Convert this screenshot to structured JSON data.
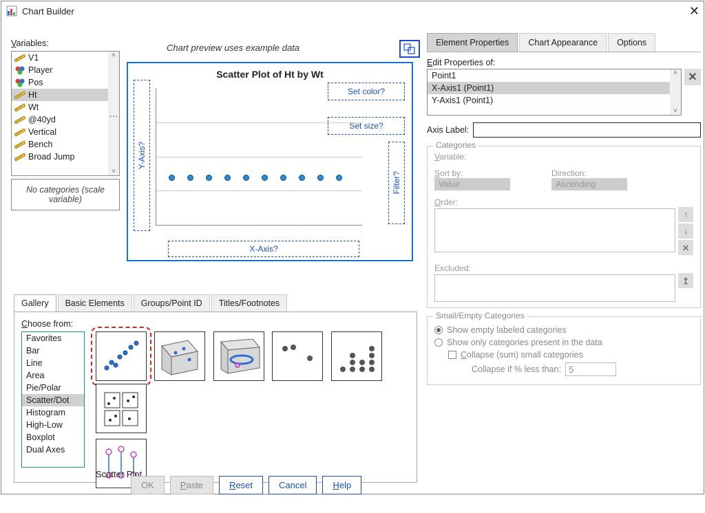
{
  "window": {
    "title": "Chart Builder"
  },
  "left": {
    "variables_label": "Variables:",
    "variables": [
      "V1",
      "Player",
      "Pos",
      "Ht",
      "Wt",
      "@40yd",
      "Vertical",
      "Bench",
      "Broad Jump"
    ],
    "selected_variable_index": 3,
    "no_categories": "No categories (scale variable)",
    "preview_hint": "Chart preview uses example data"
  },
  "chart_data": {
    "type": "scatter",
    "title": "Scatter Plot of Ht by Wt",
    "x": [
      1,
      2,
      3,
      4,
      5,
      6,
      7,
      8,
      9,
      10
    ],
    "y": [
      0,
      0,
      0,
      0,
      0,
      0,
      0,
      0,
      0,
      0
    ],
    "xlabel": "",
    "ylabel": "",
    "dropzones": {
      "color": "Set color?",
      "size": "Set size?",
      "filter": "Filter?",
      "x": "X-Axis?",
      "y": "Y-Axis?"
    }
  },
  "gallery": {
    "tabs": [
      "Gallery",
      "Basic Elements",
      "Groups/Point ID",
      "Titles/Footnotes"
    ],
    "active_tab": 0,
    "choose_from_label": "Choose from:",
    "types": [
      "Favorites",
      "Bar",
      "Line",
      "Area",
      "Pie/Polar",
      "Scatter/Dot",
      "Histogram",
      "High-Low",
      "Boxplot",
      "Dual Axes"
    ],
    "selected_type_index": 5,
    "selected_thumb_label": "Scatter Plot"
  },
  "buttons": {
    "ok": "OK",
    "paste": "Paste",
    "reset": "Reset",
    "cancel": "Cancel",
    "help": "Help"
  },
  "right": {
    "tabs": [
      "Element Properties",
      "Chart Appearance",
      "Options"
    ],
    "active_tab": 0,
    "edit_props_label": "Edit Properties of:",
    "props_list": [
      "Point1",
      "X-Axis1 (Point1)",
      "Y-Axis1 (Point1)"
    ],
    "selected_prop_index": 1,
    "axis_label_label": "Axis Label:",
    "axis_label_value": "",
    "categories": {
      "title": "Categories",
      "variable_label": "Variable:",
      "sort_by_label": "Sort by:",
      "sort_by_value": "Value",
      "direction_label": "Direction:",
      "direction_value": "Ascending",
      "order_label": "Order:",
      "excluded_label": "Excluded:"
    },
    "small_empty": {
      "title": "Small/Empty Categories",
      "opt1": "Show empty labeled categories",
      "opt2": "Show only categories present in the data",
      "collapse_label": "Collapse (sum) small categories",
      "collapse_pct_label": "Collapse if % less than:",
      "collapse_pct_value": "5"
    }
  }
}
